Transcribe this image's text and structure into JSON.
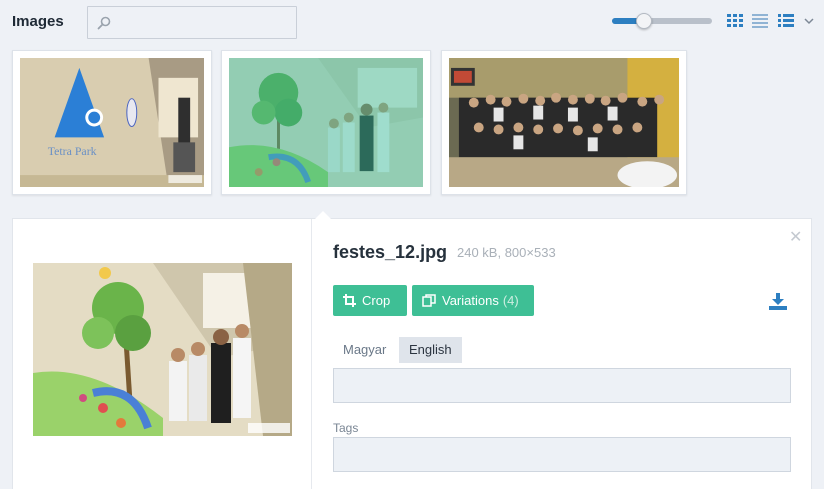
{
  "header": {
    "title": "Images",
    "search_placeholder": "",
    "zoom_level": 0.32
  },
  "thumbnails": [
    {
      "name": "tetra-park-mural",
      "selected": false
    },
    {
      "name": "festes_12.jpg",
      "selected": true
    },
    {
      "name": "group-photo",
      "selected": false
    }
  ],
  "detail": {
    "filename": "festes_12.jpg",
    "meta": "240 kB, 800×533",
    "crop_label": "Crop",
    "variations_label": "Variations",
    "variations_count": "(4)",
    "tabs": [
      {
        "label": "Magyar",
        "active": false
      },
      {
        "label": "English",
        "active": true
      }
    ],
    "description_value": "",
    "tags_label": "Tags",
    "tags_value": ""
  },
  "colors": {
    "accent_green": "#3ebf95",
    "slider_fill": "#2d7fc1",
    "view_active": "#2d7fc1",
    "view_inactive": "#8fb3d4"
  }
}
